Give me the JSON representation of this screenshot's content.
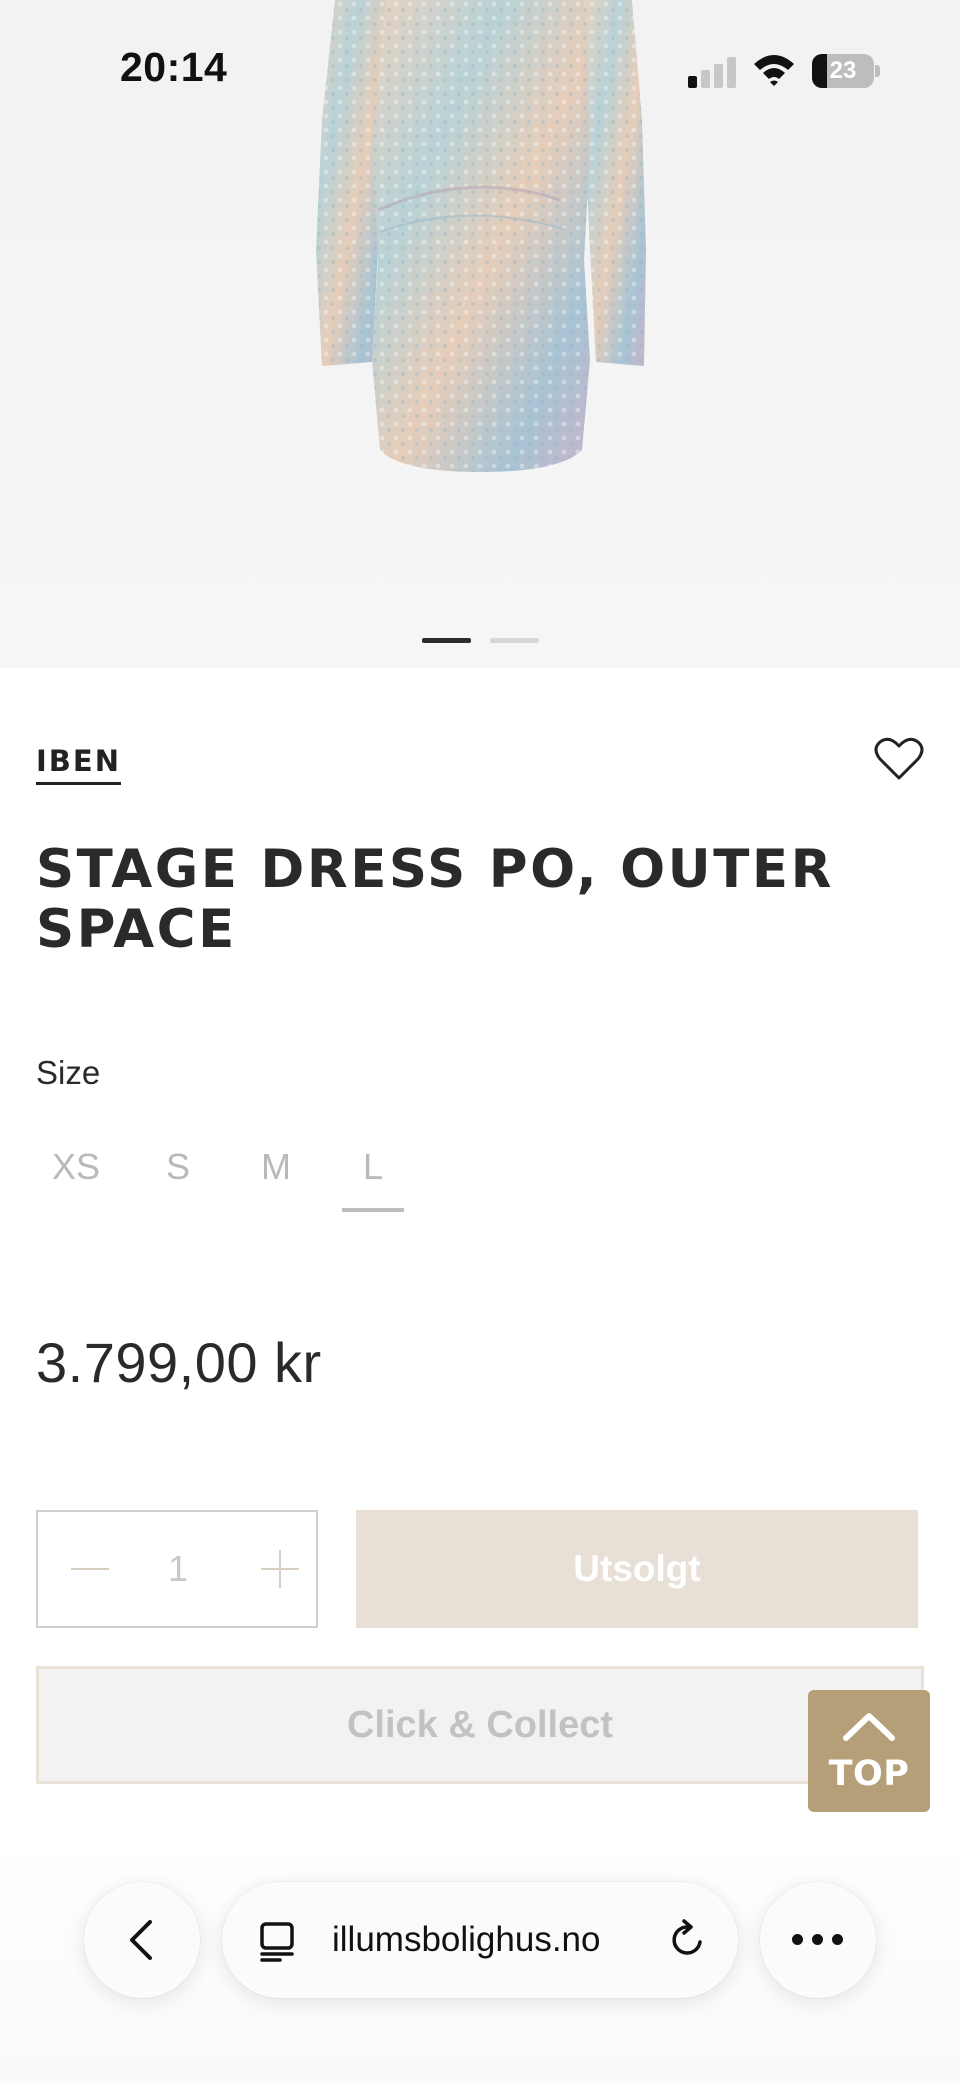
{
  "status_bar": {
    "time": "20:14",
    "battery_level": "23"
  },
  "gallery": {
    "image_count": 2,
    "active_index": 0
  },
  "product": {
    "brand": "IBEN",
    "title": "STAGE DRESS PO, OUTER SPACE",
    "size_label": "Size",
    "sizes": [
      "XS",
      "S",
      "M",
      "L"
    ],
    "selected_size": "L",
    "price": "3.799,00 kr"
  },
  "purchase": {
    "quantity": "1",
    "sold_out_label": "Utsolgt",
    "click_collect_label": "Click & Collect",
    "top_label": "TOP"
  },
  "browser": {
    "url": "illumsbolighus.no"
  },
  "colors": {
    "sold_out_bg": "#e8e0d6",
    "top_button_bg": "#b59f78",
    "text": "#2a2a2a"
  },
  "icons": {
    "wishlist": "heart-icon",
    "back": "chevron-left-icon",
    "reader": "reader-icon",
    "reload": "reload-icon",
    "more": "more-icon",
    "top": "chevron-up-icon"
  }
}
